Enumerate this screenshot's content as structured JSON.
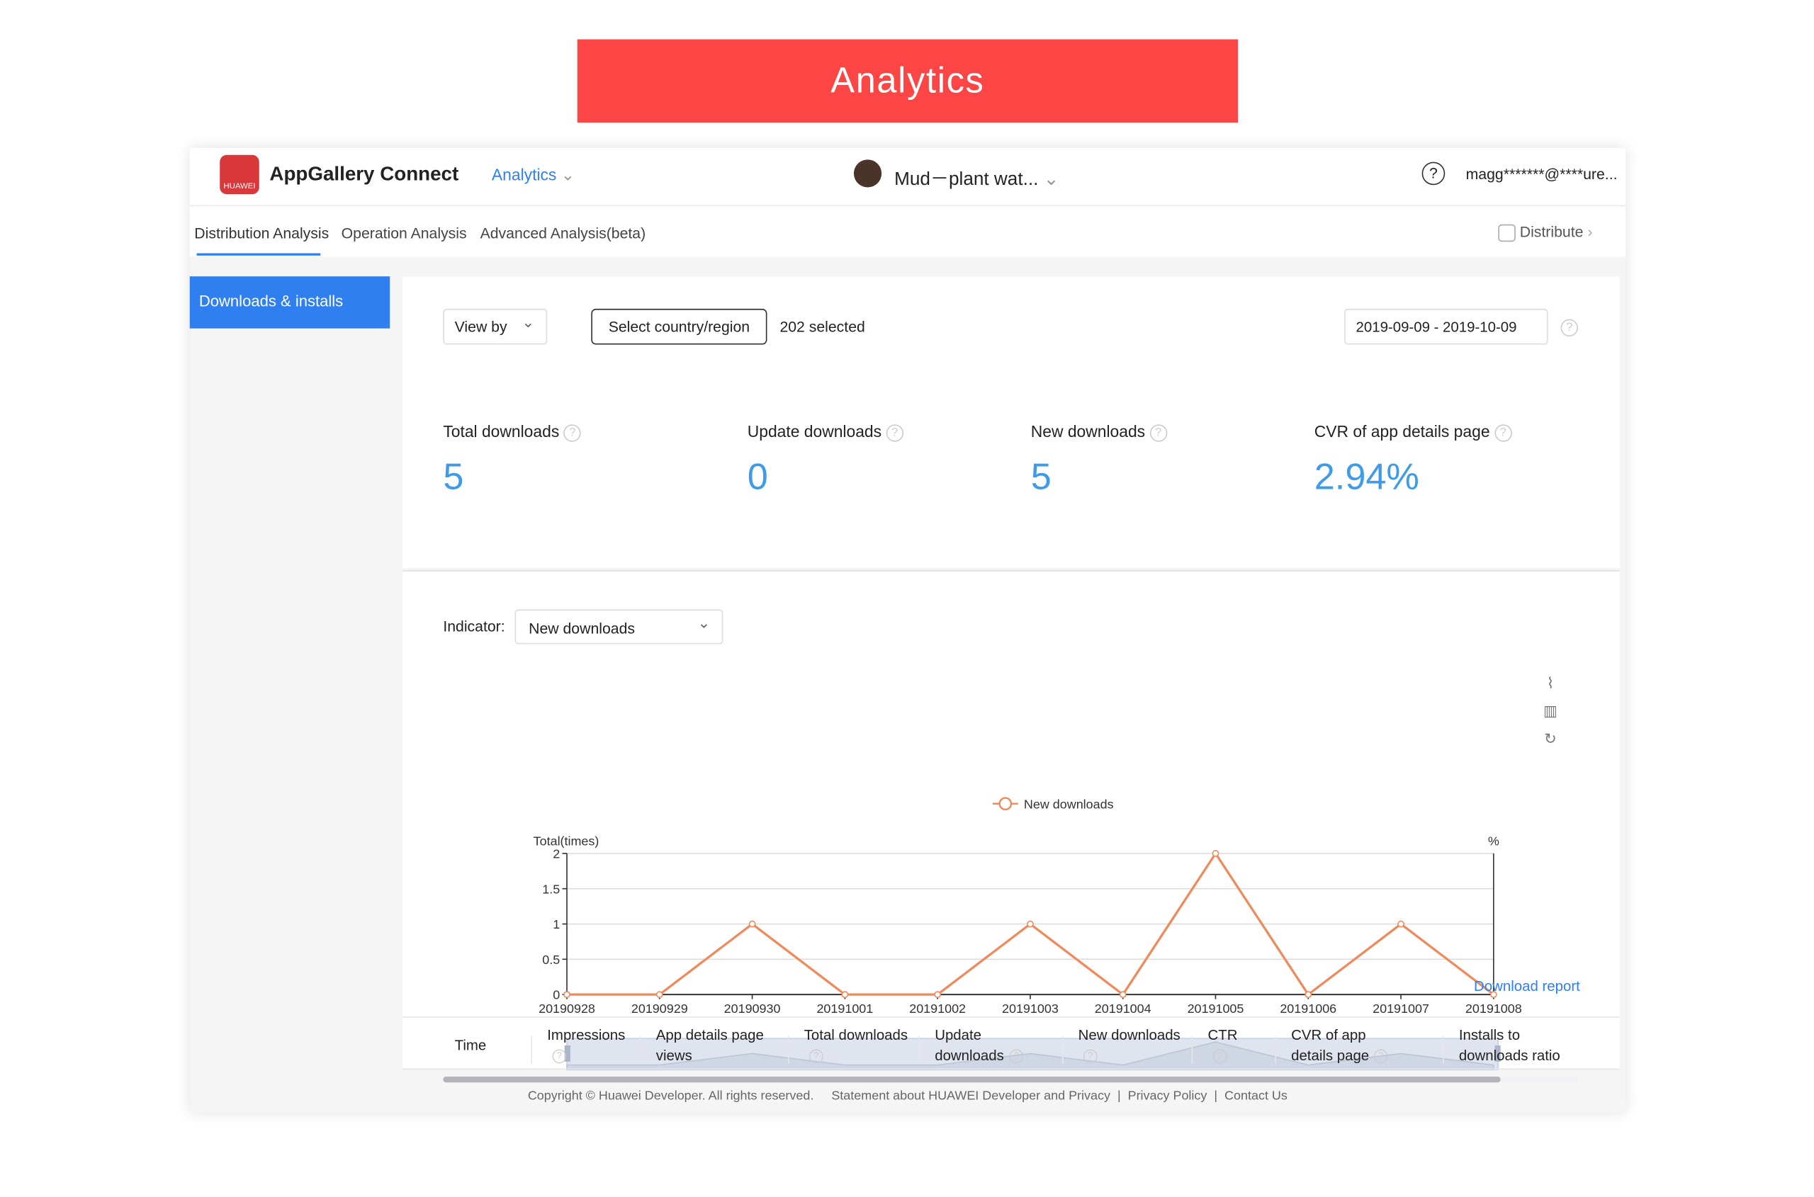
{
  "banner": {
    "title": "Analytics"
  },
  "header": {
    "brand": "AppGallery Connect",
    "logo_text": "HUAWEI",
    "menu": "Analytics",
    "app_name": "Mud－plant wat...",
    "user": "magg*******@****ure..."
  },
  "tabs": [
    {
      "label": "Distribution Analysis",
      "active": true
    },
    {
      "label": "Operation Analysis"
    },
    {
      "label": "Advanced Analysis(beta)"
    }
  ],
  "distribute": "Distribute",
  "sidebar": {
    "items": [
      {
        "label": "Downloads & installs",
        "active": true
      }
    ]
  },
  "filters": {
    "view_by": "View by",
    "country_button": "Select country/region",
    "selected": "202 selected",
    "date_range": "2019-09-09 - 2019-10-09"
  },
  "metrics": [
    {
      "label": "Total downloads",
      "value": "5"
    },
    {
      "label": "Update downloads",
      "value": "0"
    },
    {
      "label": "New downloads",
      "value": "5"
    },
    {
      "label": "CVR of app details page",
      "value": "2.94%"
    }
  ],
  "indicator": {
    "label": "Indicator:",
    "value": "New downloads"
  },
  "colors": {
    "accent": "#2f7ff0",
    "banner": "#fc4646",
    "series": "#ee8a5c",
    "metric": "#3d9be9"
  },
  "chart_data": {
    "type": "line",
    "legend": [
      "New downloads"
    ],
    "legend_placement": "top-center",
    "ylabel": "Total(times)",
    "y2label": "%",
    "ylim": [
      0,
      2
    ],
    "yticks": [
      "0",
      "0.5",
      "1",
      "1.5",
      "2"
    ],
    "grid": true,
    "x": [
      "20190928",
      "20190929",
      "20190930",
      "20191001",
      "20191002",
      "20191003",
      "20191004",
      "20191005",
      "20191006",
      "20191007",
      "20191008"
    ],
    "series": [
      {
        "name": "New downloads",
        "values": [
          0,
          0,
          1,
          0,
          0,
          1,
          0,
          2,
          0,
          1,
          0
        ]
      }
    ]
  },
  "download_report": "Download report",
  "table": {
    "columns": [
      {
        "label": "Time"
      },
      {
        "label": "Impressions",
        "help": true
      },
      {
        "label": "App details page views"
      },
      {
        "label": "Total downloads",
        "help": true
      },
      {
        "label": "Update downloads",
        "help": true
      },
      {
        "label": "New downloads",
        "help": true
      },
      {
        "label": "CTR",
        "help": true
      },
      {
        "label": "CVR of app details page",
        "help": true
      },
      {
        "label": "Installs to downloads ratio"
      }
    ]
  },
  "footer": {
    "copyright": "Copyright © Huawei Developer. All rights reserved.",
    "links": [
      "Statement about HUAWEI Developer and Privacy",
      "Privacy Policy",
      "Contact Us"
    ]
  }
}
